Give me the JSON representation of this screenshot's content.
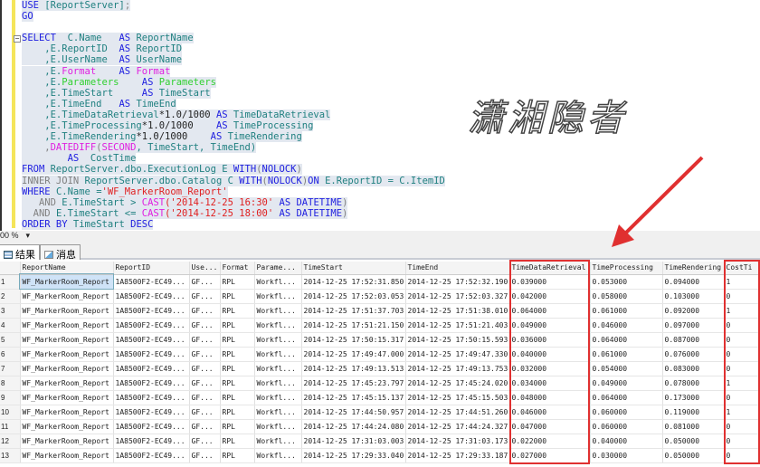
{
  "editor": {
    "lines": [
      [
        [
          "USE ",
          "kw"
        ],
        [
          "[ReportServer]",
          "id"
        ],
        [
          ";",
          "gr"
        ]
      ],
      [
        [
          "GO",
          "kw"
        ]
      ],
      [],
      [
        [
          "SELECT  ",
          "kw"
        ],
        [
          "C.Name   ",
          "id"
        ],
        [
          "AS ",
          "kw"
        ],
        [
          "ReportName",
          "id"
        ]
      ],
      [
        [
          "    ,E.ReportID  ",
          "id"
        ],
        [
          "AS ",
          "kw"
        ],
        [
          "ReportID",
          "id"
        ]
      ],
      [
        [
          "    ,E.UserName  ",
          "id"
        ],
        [
          "AS ",
          "kw"
        ],
        [
          "UserName",
          "id"
        ]
      ],
      [
        [
          "    ,E.",
          "id"
        ],
        [
          "Format",
          "fn"
        ],
        [
          "    AS ",
          "kw"
        ],
        [
          "Format",
          "fn"
        ]
      ],
      [
        [
          "    ,E.",
          "id"
        ],
        [
          "Parameters",
          "pa"
        ],
        [
          "    AS ",
          "kw"
        ],
        [
          "Parameters",
          "pa"
        ]
      ],
      [
        [
          "    ,E.TimeStart     ",
          "id"
        ],
        [
          "AS ",
          "kw"
        ],
        [
          "TimeStart",
          "id"
        ]
      ],
      [
        [
          "    ,E.TimeEnd   ",
          "id"
        ],
        [
          "AS ",
          "kw"
        ],
        [
          "TimeEnd",
          "id"
        ]
      ],
      [
        [
          "    ,E.TimeDataRetrieval",
          "id"
        ],
        [
          "*1.0/1000 ",
          "tx"
        ],
        [
          "AS ",
          "kw"
        ],
        [
          "TimeDataRetrieval",
          "id"
        ]
      ],
      [
        [
          "    ,E.TimeProcessing",
          "id"
        ],
        [
          "*1.0/1000    ",
          "tx"
        ],
        [
          "AS ",
          "kw"
        ],
        [
          "TimeProcessing",
          "id"
        ]
      ],
      [
        [
          "    ,E.TimeRendering",
          "id"
        ],
        [
          "*1.0/1000    ",
          "tx"
        ],
        [
          "AS ",
          "kw"
        ],
        [
          "TimeRendering",
          "id"
        ]
      ],
      [
        [
          "    ,",
          "gr"
        ],
        [
          "DATEDIFF",
          "fn"
        ],
        [
          "(",
          "gr"
        ],
        [
          "SECOND",
          "fn"
        ],
        [
          ", TimeStart, TimeEnd)",
          "id"
        ]
      ],
      [
        [
          "        AS  ",
          "kw"
        ],
        [
          "CostTime",
          "id"
        ]
      ],
      [
        [
          "FROM ",
          "kw"
        ],
        [
          "ReportServer.dbo.ExecutionLog E ",
          "id"
        ],
        [
          "WITH",
          "kw"
        ],
        [
          "(",
          "gr"
        ],
        [
          "NOLOCK",
          "kw"
        ],
        [
          ")",
          "gr"
        ]
      ],
      [
        [
          "INNER JOIN ",
          "gr"
        ],
        [
          "ReportServer.dbo.",
          "id"
        ],
        [
          "Catalog",
          "id"
        ],
        [
          " C ",
          "id"
        ],
        [
          "WITH",
          "kw"
        ],
        [
          "(",
          "gr"
        ],
        [
          "NOLOCK",
          "kw"
        ],
        [
          ")",
          "gr"
        ],
        [
          "ON ",
          "kw"
        ],
        [
          "E.ReportID = C.ItemID",
          "id"
        ]
      ],
      [
        [
          "WHERE ",
          "kw"
        ],
        [
          "C.Name =",
          "id"
        ],
        [
          "'WF_MarkerRoom_Report'",
          "st"
        ]
      ],
      [
        [
          "   AND ",
          "gr"
        ],
        [
          "E.TimeStart > ",
          "id"
        ],
        [
          "CAST",
          "fn"
        ],
        [
          "('2014-12-25 16:30' ",
          "st"
        ],
        [
          "AS DATETIME",
          "kw"
        ],
        [
          ")",
          "gr"
        ]
      ],
      [
        [
          "  AND ",
          "gr"
        ],
        [
          "E.TimeStart <= ",
          "id"
        ],
        [
          "CAST",
          "fn"
        ],
        [
          "('2014-12-25 18:00' ",
          "st"
        ],
        [
          "AS DATETIME",
          "kw"
        ],
        [
          ")",
          "gr"
        ]
      ],
      [
        [
          "ORDER BY ",
          "kw"
        ],
        [
          "TimeStart ",
          "id"
        ],
        [
          "DESC",
          "kw"
        ]
      ]
    ],
    "watermark": "潇湘隐者"
  },
  "zoom": {
    "level": "00 %"
  },
  "tabs": [
    {
      "label": "结果",
      "icon": "grid-icon"
    },
    {
      "label": "消息",
      "icon": "message-icon"
    }
  ],
  "grid": {
    "columns": [
      "ReportName",
      "ReportID",
      "Use...",
      "Format",
      "Parame...",
      "TimeStart",
      "TimeEnd",
      "TimeDataRetrieval",
      "TimeProcessing",
      "TimeRendering",
      "CostTi"
    ],
    "rows": [
      [
        "1",
        "WF_MarkerRoom_Report",
        "1A8500F2-EC49...",
        "GF...",
        "RPL",
        "Workfl...",
        "2014-12-25 17:52:31.850",
        "2014-12-25 17:52:32.190",
        "0.039000",
        "0.053000",
        "0.094000",
        "1"
      ],
      [
        "2",
        "WF_MarkerRoom_Report",
        "1A8500F2-EC49...",
        "GF...",
        "RPL",
        "Workfl...",
        "2014-12-25 17:52:03.053",
        "2014-12-25 17:52:03.327",
        "0.042000",
        "0.058000",
        "0.103000",
        "0"
      ],
      [
        "3",
        "WF_MarkerRoom_Report",
        "1A8500F2-EC49...",
        "GF...",
        "RPL",
        "Workfl...",
        "2014-12-25 17:51:37.703",
        "2014-12-25 17:51:38.010",
        "0.064000",
        "0.061000",
        "0.092000",
        "1"
      ],
      [
        "4",
        "WF_MarkerRoom_Report",
        "1A8500F2-EC49...",
        "GF...",
        "RPL",
        "Workfl...",
        "2014-12-25 17:51:21.150",
        "2014-12-25 17:51:21.403",
        "0.049000",
        "0.046000",
        "0.097000",
        "0"
      ],
      [
        "5",
        "WF_MarkerRoom_Report",
        "1A8500F2-EC49...",
        "GF...",
        "RPL",
        "Workfl...",
        "2014-12-25 17:50:15.317",
        "2014-12-25 17:50:15.593",
        "0.036000",
        "0.064000",
        "0.087000",
        "0"
      ],
      [
        "6",
        "WF_MarkerRoom_Report",
        "1A8500F2-EC49...",
        "GF...",
        "RPL",
        "Workfl...",
        "2014-12-25 17:49:47.000",
        "2014-12-25 17:49:47.330",
        "0.040000",
        "0.061000",
        "0.076000",
        "0"
      ],
      [
        "7",
        "WF_MarkerRoom_Report",
        "1A8500F2-EC49...",
        "GF...",
        "RPL",
        "Workfl...",
        "2014-12-25 17:49:13.513",
        "2014-12-25 17:49:13.753",
        "0.032000",
        "0.054000",
        "0.083000",
        "0"
      ],
      [
        "8",
        "WF_MarkerRoom_Report",
        "1A8500F2-EC49...",
        "GF...",
        "RPL",
        "Workfl...",
        "2014-12-25 17:45:23.797",
        "2014-12-25 17:45:24.020",
        "0.034000",
        "0.049000",
        "0.078000",
        "1"
      ],
      [
        "9",
        "WF_MarkerRoom_Report",
        "1A8500F2-EC49...",
        "GF...",
        "RPL",
        "Workfl...",
        "2014-12-25 17:45:15.137",
        "2014-12-25 17:45:15.503",
        "0.048000",
        "0.064000",
        "0.173000",
        "0"
      ],
      [
        "10",
        "WF_MarkerRoom_Report",
        "1A8500F2-EC49...",
        "GF...",
        "RPL",
        "Workfl...",
        "2014-12-25 17:44:50.957",
        "2014-12-25 17:44:51.260",
        "0.046000",
        "0.060000",
        "0.119000",
        "1"
      ],
      [
        "11",
        "WF_MarkerRoom_Report",
        "1A8500F2-EC49...",
        "GF...",
        "RPL",
        "Workfl...",
        "2014-12-25 17:44:24.080",
        "2014-12-25 17:44:24.327",
        "0.047000",
        "0.060000",
        "0.081000",
        "0"
      ],
      [
        "12",
        "WF_MarkerRoom_Report",
        "1A8500F2-EC49...",
        "GF...",
        "RPL",
        "Workfl...",
        "2014-12-25 17:31:03.003",
        "2014-12-25 17:31:03.173",
        "0.022000",
        "0.040000",
        "0.050000",
        "0"
      ],
      [
        "13",
        "WF_MarkerRoom_Report",
        "1A8500F2-EC49...",
        "GF...",
        "RPL",
        "Workfl...",
        "2014-12-25 17:29:33.040",
        "2014-12-25 17:29:33.187",
        "0.027000",
        "0.030000",
        "0.050000",
        "0"
      ]
    ]
  },
  "annotation": {
    "color": "#e03030"
  }
}
